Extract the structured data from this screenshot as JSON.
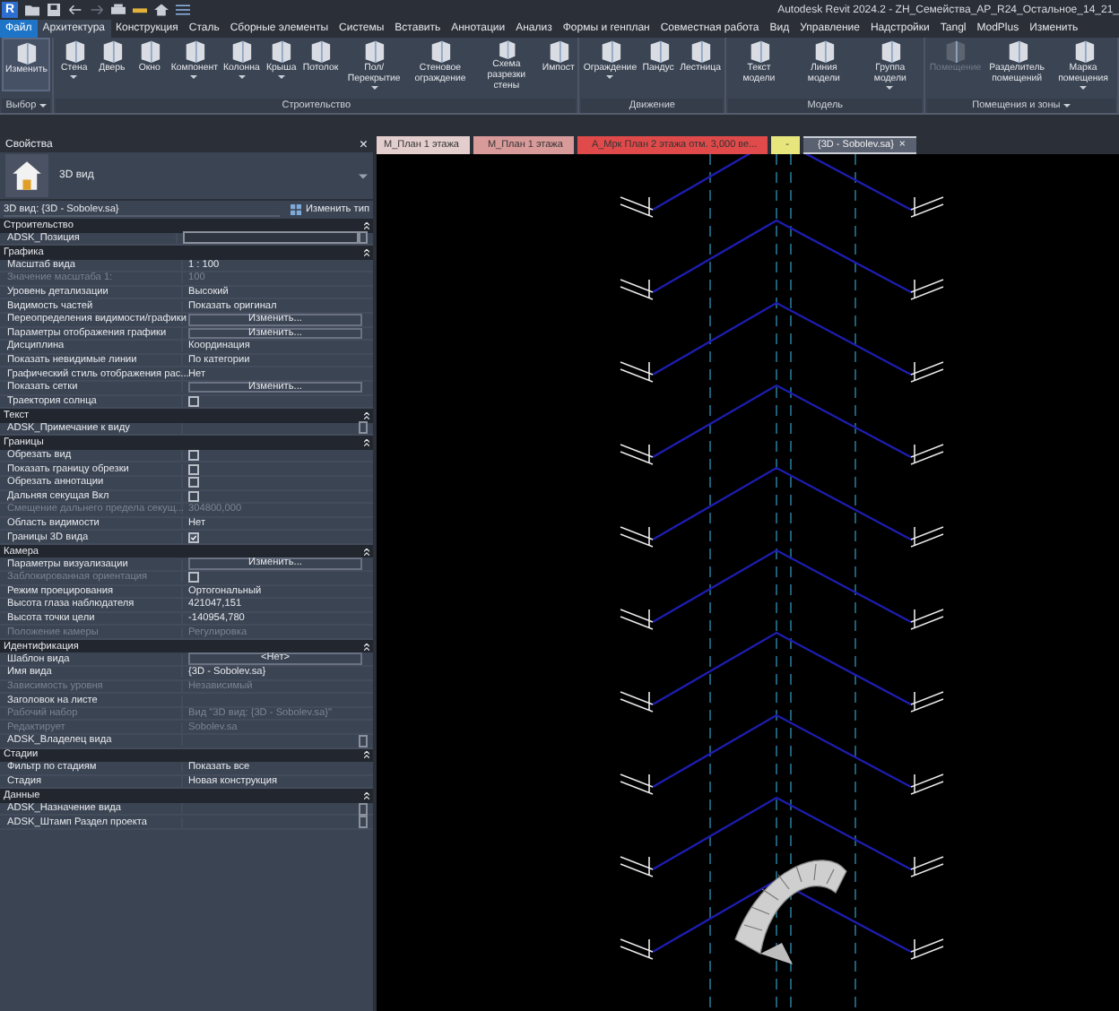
{
  "app_logo": "R",
  "window": {
    "title": "Autodesk Revit 2024.2 - ZH_Семейства_АР_R24_Остальное_14_21_"
  },
  "ribbon_tabs": [
    {
      "label": "Файл",
      "kind": "file",
      "selected": false
    },
    {
      "label": "Архитектура",
      "kind": "tab",
      "selected": true
    },
    {
      "label": "Конструкция",
      "kind": "tab",
      "selected": false
    },
    {
      "label": "Сталь",
      "kind": "tab",
      "selected": false
    },
    {
      "label": "Сборные элементы",
      "kind": "tab",
      "selected": false
    },
    {
      "label": "Системы",
      "kind": "tab",
      "selected": false
    },
    {
      "label": "Вставить",
      "kind": "tab",
      "selected": false
    },
    {
      "label": "Аннотации",
      "kind": "tab",
      "selected": false
    },
    {
      "label": "Анализ",
      "kind": "tab",
      "selected": false
    },
    {
      "label": "Формы и генплан",
      "kind": "tab",
      "selected": false
    },
    {
      "label": "Совместная работа",
      "kind": "tab",
      "selected": false
    },
    {
      "label": "Вид",
      "kind": "tab",
      "selected": false
    },
    {
      "label": "Управление",
      "kind": "tab",
      "selected": false
    },
    {
      "label": "Надстройки",
      "kind": "tab",
      "selected": false
    },
    {
      "label": "Tangl",
      "kind": "tab",
      "selected": false
    },
    {
      "label": "ModPlus",
      "kind": "tab",
      "selected": false
    },
    {
      "label": "Изменить",
      "kind": "tab",
      "selected": false
    }
  ],
  "ribbon_panels": [
    {
      "label": "Выбор",
      "dropdown": true,
      "tools": [
        {
          "label": "Изменить",
          "dropdown": false,
          "disabled": false,
          "selected": true
        }
      ]
    },
    {
      "label": "Строительство",
      "dropdown": false,
      "tools": [
        {
          "label": "Стена",
          "dropdown": true,
          "disabled": false,
          "selected": false
        },
        {
          "label": "Дверь",
          "dropdown": false,
          "disabled": false,
          "selected": false
        },
        {
          "label": "Окно",
          "dropdown": false,
          "disabled": false,
          "selected": false
        },
        {
          "label": "Компонент",
          "dropdown": true,
          "disabled": false,
          "selected": false
        },
        {
          "label": "Колонна",
          "dropdown": true,
          "disabled": false,
          "selected": false
        },
        {
          "label": "Крыша",
          "dropdown": true,
          "disabled": false,
          "selected": false
        },
        {
          "label": "Потолок",
          "dropdown": false,
          "disabled": false,
          "selected": false
        },
        {
          "label": "Пол/Перекрытие",
          "dropdown": true,
          "disabled": false,
          "selected": false
        },
        {
          "label": "Стеновое ограждение",
          "dropdown": false,
          "disabled": false,
          "selected": false
        },
        {
          "label": "Схема разрезки стены",
          "dropdown": false,
          "disabled": false,
          "selected": false
        },
        {
          "label": "Импост",
          "dropdown": false,
          "disabled": false,
          "selected": false
        }
      ]
    },
    {
      "label": "Движение",
      "dropdown": false,
      "tools": [
        {
          "label": "Ограждение",
          "dropdown": true,
          "disabled": false,
          "selected": false
        },
        {
          "label": "Пандус",
          "dropdown": false,
          "disabled": false,
          "selected": false
        },
        {
          "label": "Лестница",
          "dropdown": false,
          "disabled": false,
          "selected": false
        }
      ]
    },
    {
      "label": "Модель",
      "dropdown": false,
      "tools": [
        {
          "label": "Текст модели",
          "dropdown": false,
          "disabled": false,
          "selected": false
        },
        {
          "label": "Линия модели",
          "dropdown": false,
          "disabled": false,
          "selected": false
        },
        {
          "label": "Группа модели",
          "dropdown": true,
          "disabled": false,
          "selected": false
        }
      ]
    },
    {
      "label": "Помещения и зоны",
      "dropdown": true,
      "tools": [
        {
          "label": "Помещение",
          "dropdown": false,
          "disabled": true,
          "selected": false
        },
        {
          "label": "Разделитель помещений",
          "dropdown": false,
          "disabled": false,
          "selected": false
        },
        {
          "label": "Марка помещения",
          "dropdown": true,
          "disabled": false,
          "selected": false
        }
      ]
    }
  ],
  "properties": {
    "title": "Свойства",
    "close": "×",
    "type_name": "3D вид",
    "instance": "3D вид: {3D - Sobolev.sa}",
    "edit_type": "Изменить тип",
    "groups": [
      {
        "name": "Строительство",
        "rows": [
          {
            "name": "ADSK_Позиция",
            "kind": "field",
            "disabled": false
          }
        ]
      },
      {
        "name": "Графика",
        "rows": [
          {
            "name": "Масштаб вида",
            "kind": "text",
            "value": "1 : 100",
            "disabled": false
          },
          {
            "name": "Значение масштаба    1:",
            "kind": "text",
            "value": "100",
            "disabled": true
          },
          {
            "name": "Уровень детализации",
            "kind": "text",
            "value": "Высокий",
            "disabled": false
          },
          {
            "name": "Видимость частей",
            "kind": "text",
            "value": "Показать оригинал",
            "disabled": false
          },
          {
            "name": "Переопределения видимости/графики",
            "kind": "button",
            "value": "Изменить...",
            "disabled": false
          },
          {
            "name": "Параметры отображения графики",
            "kind": "button",
            "value": "Изменить...",
            "disabled": false
          },
          {
            "name": "Дисциплина",
            "kind": "text",
            "value": "Координация",
            "disabled": false
          },
          {
            "name": "Показать невидимые линии",
            "kind": "text",
            "value": "По категории",
            "disabled": false
          },
          {
            "name": "Графический стиль отображения рас...",
            "kind": "text",
            "value": "Нет",
            "disabled": false
          },
          {
            "name": "Показать сетки",
            "kind": "button",
            "value": "Изменить...",
            "disabled": false
          },
          {
            "name": "Траектория солнца",
            "kind": "check",
            "checked": false,
            "disabled": false
          }
        ]
      },
      {
        "name": "Текст",
        "rows": [
          {
            "name": "ADSK_Примечание к виду",
            "kind": "param",
            "disabled": false
          }
        ]
      },
      {
        "name": "Границы",
        "rows": [
          {
            "name": "Обрезать вид",
            "kind": "check",
            "checked": false,
            "disabled": false
          },
          {
            "name": "Показать границу обрезки",
            "kind": "check",
            "checked": false,
            "disabled": false
          },
          {
            "name": "Обрезать аннотации",
            "kind": "check",
            "checked": false,
            "disabled": false
          },
          {
            "name": "Дальняя секущая Вкл",
            "kind": "check",
            "checked": false,
            "disabled": false
          },
          {
            "name": "Смещение дальнего предела секущ...",
            "kind": "text",
            "value": "304800,000",
            "disabled": true
          },
          {
            "name": "Область видимости",
            "kind": "text",
            "value": "Нет",
            "disabled": false
          },
          {
            "name": "Границы 3D вида",
            "kind": "check",
            "checked": true,
            "disabled": false
          }
        ]
      },
      {
        "name": "Камера",
        "rows": [
          {
            "name": "Параметры визуализации",
            "kind": "button",
            "value": "Изменить...",
            "disabled": false
          },
          {
            "name": "Заблокированная ориентация",
            "kind": "check",
            "checked": false,
            "disabled": true
          },
          {
            "name": "Режим проецирования",
            "kind": "text",
            "value": "Ортогональный",
            "disabled": false
          },
          {
            "name": "Высота глаза наблюдателя",
            "kind": "text",
            "value": "421047,151",
            "disabled": false
          },
          {
            "name": "Высота точки цели",
            "kind": "text",
            "value": "-140954,780",
            "disabled": false
          },
          {
            "name": "Положение камеры",
            "kind": "text",
            "value": "Регулировка",
            "disabled": true
          }
        ]
      },
      {
        "name": "Идентификация",
        "rows": [
          {
            "name": "Шаблон вида",
            "kind": "button",
            "value": "<Нет>",
            "disabled": false
          },
          {
            "name": "Имя вида",
            "kind": "text",
            "value": "{3D - Sobolev.sa}",
            "disabled": false
          },
          {
            "name": "Зависимость уровня",
            "kind": "text",
            "value": "Независимый",
            "disabled": true
          },
          {
            "name": "Заголовок на листе",
            "kind": "text",
            "disabled": false
          },
          {
            "name": "Рабочий набор",
            "kind": "text",
            "value": "Вид \"3D вид: {3D - Sobolev.sa}\"",
            "disabled": true
          },
          {
            "name": "Редактирует",
            "kind": "text",
            "value": "Sobolev.sa",
            "disabled": true
          },
          {
            "name": "ADSK_Владелец вида",
            "kind": "param",
            "disabled": false
          }
        ]
      },
      {
        "name": "Стадии",
        "rows": [
          {
            "name": "Фильтр по стадиям",
            "kind": "text",
            "value": "Показать все",
            "disabled": false
          },
          {
            "name": "Стадия",
            "kind": "text",
            "value": "Новая конструкция",
            "disabled": false
          }
        ]
      },
      {
        "name": "Данные",
        "rows": [
          {
            "name": "ADSK_Назначение вида",
            "kind": "param",
            "disabled": false
          },
          {
            "name": "ADSK_Штамп Раздел проекта",
            "kind": "param",
            "disabled": false
          }
        ]
      }
    ]
  },
  "view_tabs": [
    {
      "label": "M_План 1 этажа",
      "color": "#e3cdcd",
      "selected": false
    },
    {
      "label": "M_План 1 этажа",
      "color": "#d99a9a",
      "selected": false
    },
    {
      "label": "А_Мрк План 2 этажа отм. 3,000 ве...",
      "color": "#e04a4a",
      "selected": false
    },
    {
      "label": "-",
      "color": "#e6e67c",
      "selected": false
    },
    {
      "label": "{3D - Sobolev.sa}",
      "color": "#5a6170",
      "selected": true,
      "close": "×"
    }
  ]
}
